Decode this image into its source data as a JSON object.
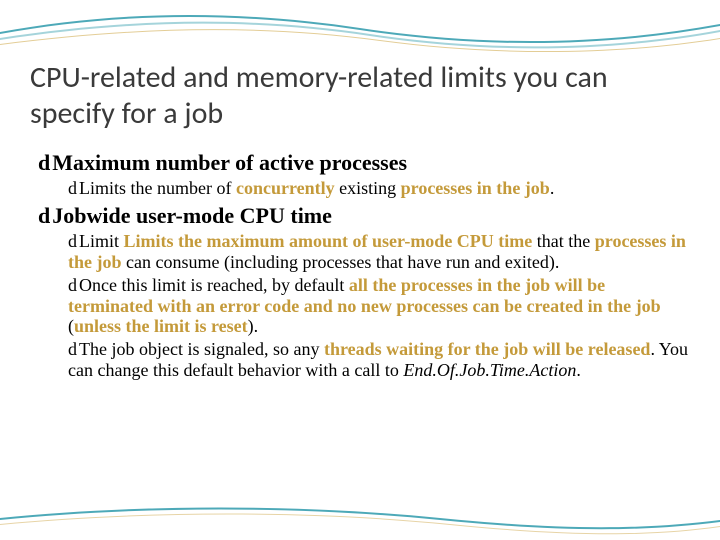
{
  "title": "CPU-related and memory-related limits you can specify for a job",
  "b1": {
    "text": "Maximum number of active processes"
  },
  "b1s1": {
    "pre": "Limits the number of ",
    "hl1": "concurrently",
    "mid": " existing ",
    "hl2": "processes in the job",
    "post": "."
  },
  "b2": {
    "text": "Jobwide user-mode CPU time"
  },
  "b2s1": {
    "pre": "Limit ",
    "hl1": "Limits the maximum amount of user-mode CPU time",
    "mid1": " that the ",
    "hl2": "processes in the job",
    "post": " can consume (including processes that have run and exited)."
  },
  "b2s2": {
    "pre": "Once this limit is reached, by default ",
    "hl1": "all the processes in the job will be terminated with an error code and no new processes can be created in the job",
    "mid": " (",
    "hl2": "unless the limit is reset",
    "post": ")."
  },
  "b2s3": {
    "pre": "The job object is signaled, so any ",
    "hl1": "threads waiting for the job will be released",
    "mid": ". You can change this default behavior with a call to ",
    "ital": "End.Of.Job.Time.Action",
    "post": "."
  },
  "glyph": "d"
}
